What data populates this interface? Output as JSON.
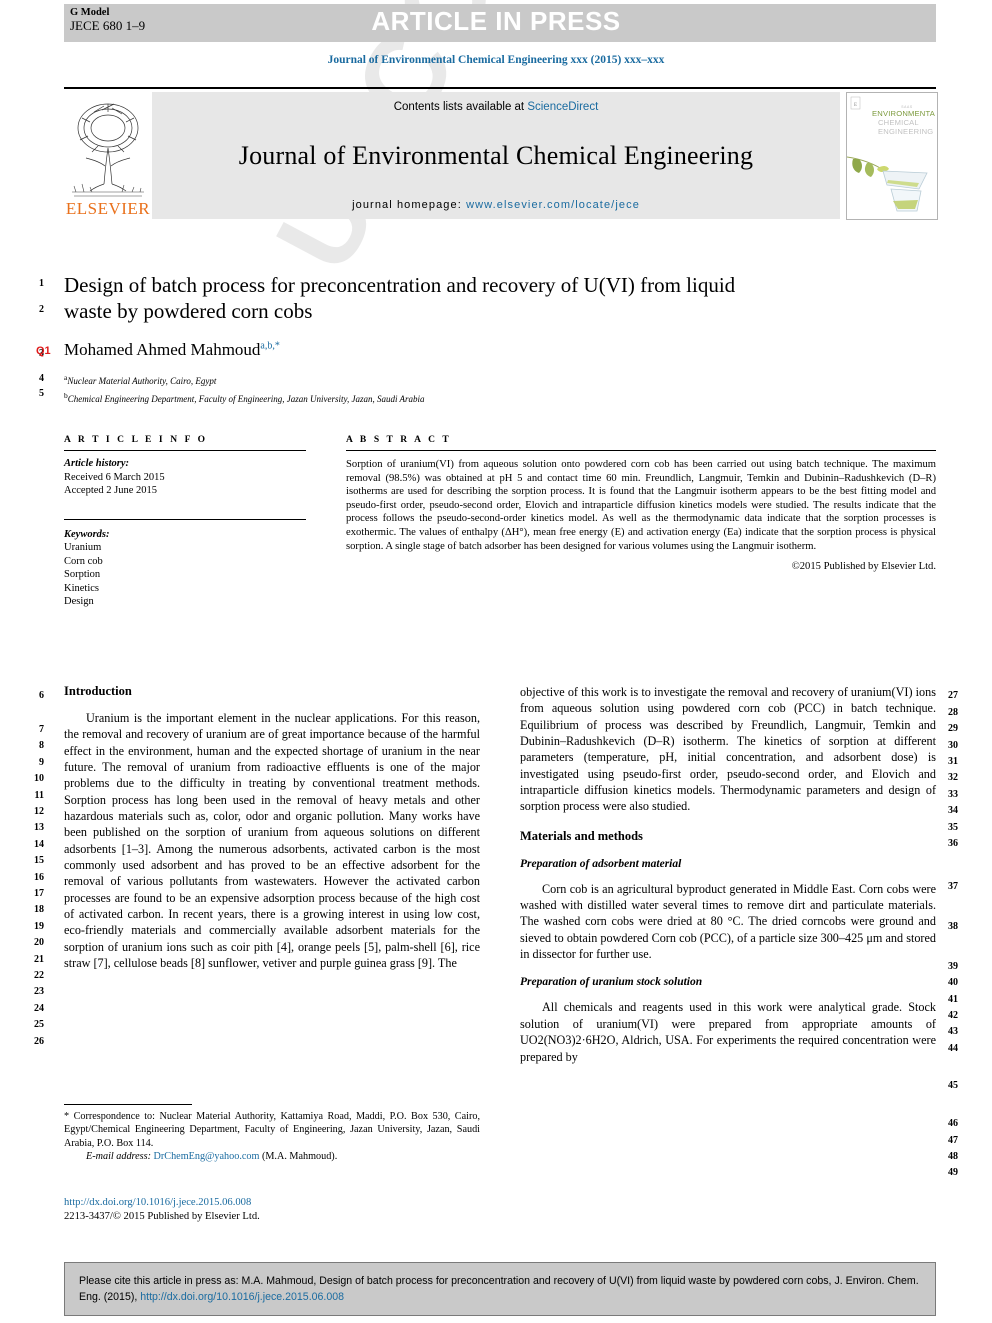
{
  "header": {
    "g_model_label": "G Model",
    "g_model_code": "JECE 680 1–9",
    "article_in_press": "ARTICLE IN PRESS",
    "running_head": "Journal of Environmental Chemical Engineering xxx (2015) xxx–xxx"
  },
  "masthead": {
    "contents_prefix": "Contents lists available at ",
    "sciencedirect": "ScienceDirect",
    "journal_title": "Journal of Environmental Chemical Engineering",
    "homepage_label": "journal homepage: ",
    "homepage_url": "www.elsevier.com/locate/jece",
    "publisher_logo": "ELSEVIER",
    "cover_line1": "ENVIRONMENTAL",
    "cover_line2": "CHEMICAL",
    "cover_line3": "ENGINEERING"
  },
  "title_block": {
    "title": "Design of batch process for preconcentration and recovery of U(VI) from liquid waste by powdered corn cobs",
    "query_badge": "Q1",
    "author": "Mohamed Ahmed Mahmoud",
    "author_superscript": "a,b,*",
    "affiliations": [
      {
        "marker": "a",
        "text": "Nuclear Material Authority, Cairo, Egypt"
      },
      {
        "marker": "b",
        "text": "Chemical Engineering Department, Faculty of Engineering, Jazan University, Jazan, Saudi Arabia"
      }
    ]
  },
  "article_info": {
    "heading": "A R T I C L E    I N F O",
    "history_label": "Article history:",
    "history": [
      "Received 6 March 2015",
      "Accepted 2 June 2015"
    ],
    "keywords_label": "Keywords:",
    "keywords": [
      "Uranium",
      "Corn cob",
      "Sorption",
      "Kinetics",
      "Design"
    ]
  },
  "abstract": {
    "heading": "A B S T R A C T",
    "text": "Sorption of uranium(VI) from aqueous solution onto powdered corn cob has been carried out using batch technique. The maximum removal (98.5%) was obtained at pH 5 and contact time 60 min. Freundlich, Langmuir, Temkin and Dubinin–Radushkevich (D–R) isotherms are used for describing the sorption process. It is found that the Langmuir isotherm appears to be the best fitting model and pseudo-first order, pseudo-second order, Elovich and intraparticle diffusion kinetics models were studied. The results indicate that the process follows the pseudo-second-order kinetics model. As well as the thermodynamic data indicate that the sorption processes is exothermic. The values of enthalpy (ΔH°), mean free energy (E) and activation energy (Ea) indicate that the sorption process is physical sorption. A single stage of batch adsorber has been designed for various volumes using the Langmuir isotherm.",
    "copyright": "©2015 Published by Elsevier Ltd."
  },
  "body": {
    "left": {
      "section_heading": "Introduction",
      "paragraph_1": "Uranium is the important element in the nuclear applications. For this reason, the removal and recovery of uranium are of great importance because of the harmful effect in the environment, human and the expected shortage of uranium in the near future. The removal of uranium from radioactive effluents is one of the major problems due to the difficulty in treating by conventional treatment methods. Sorption process has long been used in the removal of heavy metals and other hazardous materials such as, color, odor and organic pollution. Many works have been published on the sorption of uranium from aqueous solutions on different adsorbents [1–3]. Among the numerous adsorbents, activated carbon is the most commonly used adsorbent and has proved to be an effective adsorbent for the removal of various pollutants from wastewaters. However the activated carbon processes are found to be an expensive adsorption process because of the high cost of activated carbon. In recent years, there is a growing interest in using low cost, eco-friendly materials and commercially available adsorbent materials for the sorption of uranium ions such as coir pith [4], orange peels [5], palm-shell [6], rice straw [7], cellulose beads [8] sunflower, vetiver and purple guinea grass [9]. The"
    },
    "right": {
      "paragraph_continued": "objective of this work is to investigate the removal and recovery of uranium(VI) ions from aqueous solution using powdered corn cob (PCC) in batch technique. Equilibrium of process was described by Freundlich, Langmuir, Temkin and Dubinin–Radushkevich (D–R) isotherm. The kinetics of sorption at different parameters (temperature, pH, initial concentration, and adsorbent dose) is investigated using pseudo-first order, pseudo-second order, and Elovich and intraparticle diffusion kinetics models. Thermodynamic parameters and design of sorption process were also studied.",
      "section_heading": "Materials and methods",
      "sub_heading_1": "Preparation of adsorbent material",
      "paragraph_2": "Corn cob is an agricultural byproduct generated in Middle East. Corn cobs were washed with distilled water several times to remove dirt and particulate materials. The washed corn cobs were dried at 80 °C. The dried corncobs were ground and sieved to obtain powdered Corn cob (PCC), of a particle size 300–425 μm and stored in dissector for further use.",
      "sub_heading_2": "Preparation of uranium stock solution",
      "paragraph_3": "All chemicals and reagents used in this work were analytical grade. Stock solution of uranium(VI) were prepared from appropriate amounts of UO2(NO3)2·6H2O, Aldrich, USA. For experiments the required concentration were prepared by"
    }
  },
  "footnote": {
    "text": "* Correspondence to: Nuclear Material Authority, Kattamiya Road, Maddi, P.O. Box 530, Cairo, Egypt/Chemical Engineering Department, Faculty of Engineering, Jazan University, Jazan, Saudi Arabia, P.O. Box 114.",
    "email_label": "E-mail address:",
    "email": "DrChemEng@yahoo.com",
    "email_owner": "(M.A. Mahmoud)."
  },
  "doi_block": {
    "doi_url": "http://dx.doi.org/10.1016/j.jece.2015.06.008",
    "issn_line": "2213-3437/© 2015 Published by Elsevier Ltd."
  },
  "cite_box": {
    "text_before": "Please cite this article in press as: M.A. Mahmoud, Design of batch process for preconcentration and recovery of U(VI) from liquid waste by powdered corn cobs, J. Environ. Chem. Eng. (2015), ",
    "doi": "http://dx.doi.org/10.1016/j.jece.2015.06.008"
  },
  "line_numbers": {
    "left": [
      "1",
      "2",
      "3",
      "4",
      "5",
      "6",
      "7",
      "8",
      "9",
      "10",
      "11",
      "12",
      "13",
      "14",
      "15",
      "16",
      "17",
      "18",
      "19",
      "20",
      "21",
      "22",
      "23",
      "24",
      "25",
      "26"
    ],
    "right": [
      "27",
      "28",
      "29",
      "30",
      "31",
      "32",
      "33",
      "34",
      "35",
      "36",
      "37",
      "38",
      "39",
      "40",
      "41",
      "42",
      "43",
      "44",
      "45",
      "46",
      "47",
      "48",
      "49"
    ]
  },
  "watermark": {
    "text": "UNCORRECTED PROOF"
  },
  "colors": {
    "link": "#1a6ba0",
    "query_badge": "#e01b1b",
    "bar_gray": "#c9c9c9",
    "mast_gray": "#e7e7e7"
  }
}
